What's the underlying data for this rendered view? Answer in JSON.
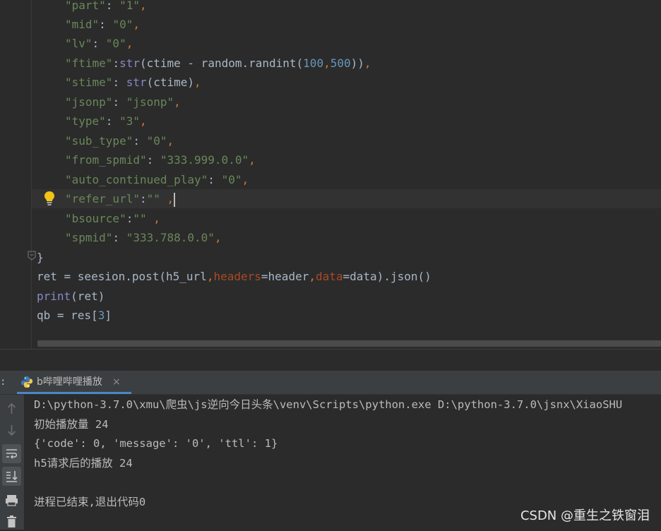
{
  "editor": {
    "lines": [
      {
        "key": "\"part\"",
        "sep": ": ",
        "val": "\"1\"",
        "tail": ","
      },
      {
        "key": "\"mid\"",
        "sep": ": ",
        "val": "\"0\"",
        "tail": ","
      },
      {
        "key": "\"lv\"",
        "sep": ": ",
        "val": "\"0\"",
        "tail": ","
      },
      {
        "ftime_key": "\"ftime\"",
        "ftime_mid": ":",
        "ftime_fn": "str",
        "ftime_open": "(ctime - random.randint(",
        "ftime_n1": "100",
        "ftime_comma1": ",",
        "ftime_n2": "500",
        "ftime_close": "))",
        "ftime_tail": ","
      },
      {
        "key": "\"stime\"",
        "sep": ": ",
        "fn": "str",
        "rest": "(ctime)",
        "tail": ","
      },
      {
        "key": "\"jsonp\"",
        "sep": ": ",
        "val": "\"jsonp\"",
        "tail": ","
      },
      {
        "key": "\"type\"",
        "sep": ": ",
        "val": "\"3\"",
        "tail": ","
      },
      {
        "key": "\"sub_type\"",
        "sep": ": ",
        "val": "\"0\"",
        "tail": ","
      },
      {
        "key": "\"from_spmid\"",
        "sep": ": ",
        "val": "\"333.999.0.0\"",
        "tail": ","
      },
      {
        "key": "\"auto_continued_play\"",
        "sep": ": ",
        "val": "\"0\"",
        "tail": ","
      },
      {
        "key": "\"refer_url\"",
        "sep": ":",
        "val": "\"\"",
        "tail": " ,"
      },
      {
        "key": "\"bsource\"",
        "sep": ":",
        "val": "\"\"",
        "tail": " ,"
      },
      {
        "key": "\"spmid\"",
        "sep": ": ",
        "val": "\"333.788.0.0\"",
        "tail": ","
      }
    ],
    "close_brace": "}",
    "post_line": {
      "a": "ret = seesion.post(h5_url",
      "c1": ",",
      "p1": "headers",
      "b": "=header",
      "c2": ",",
      "p2": "data",
      "d": "=data).json()"
    },
    "print_line": {
      "fn": "print",
      "rest": "(ret)"
    },
    "qb_line": {
      "a": "qb = res[",
      "n": "3",
      "b": "]"
    }
  },
  "run_panel": {
    "colon": ":",
    "tab_label": "b哔哩哔哩播放",
    "tab_close": "×"
  },
  "console": {
    "lines": [
      "D:\\python-3.7.0\\xmu\\爬虫\\js逆向今日头条\\venv\\Scripts\\python.exe D:\\python-3.7.0\\jsnx\\XiaoSHU",
      "初始播放量 24",
      "{'code': 0, 'message': '0', 'ttl': 1}",
      "h5请求后的播放 24",
      "",
      "进程已结束,退出代码0"
    ]
  },
  "watermark": "CSDN @重生之铁窗泪",
  "colors": {
    "background": "#2b2b2b",
    "string": "#6a8759",
    "keyword": "#cc7832",
    "number": "#6897bb",
    "builtin": "#8888c6",
    "param": "#aa4926"
  }
}
